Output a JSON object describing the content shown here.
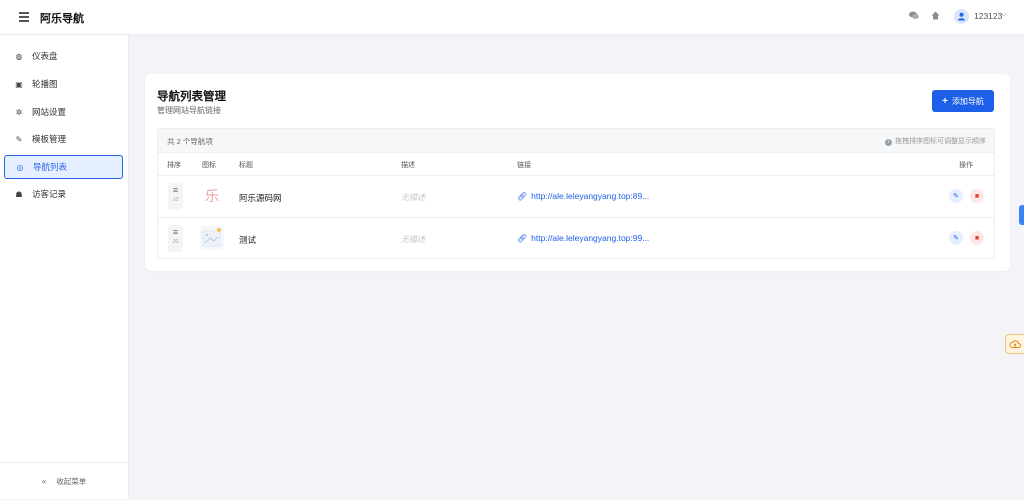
{
  "header": {
    "brand": "阿乐导航",
    "username": "123123"
  },
  "sidebar": {
    "items": [
      {
        "label": "仪表盘",
        "icon": "dashboard-icon",
        "glyph": "◍"
      },
      {
        "label": "轮播图",
        "icon": "image-icon",
        "glyph": "▣"
      },
      {
        "label": "网站设置",
        "icon": "gear-icon",
        "glyph": "✲"
      },
      {
        "label": "模板管理",
        "icon": "brush-icon",
        "glyph": "✎"
      },
      {
        "label": "导航列表",
        "icon": "compass-icon",
        "glyph": "◎"
      },
      {
        "label": "访客记录",
        "icon": "users-icon",
        "glyph": "☗"
      }
    ],
    "active_index": 4,
    "collapse_label": "收起菜单"
  },
  "card": {
    "title": "导航列表管理",
    "subtitle": "管理网站导航链接",
    "add_button_label": "添加导航"
  },
  "table": {
    "count_text": "共 2 个导航项",
    "hint_text": "拖拽排序图标可调整显示顺序",
    "columns": [
      "排序",
      "图标",
      "标题",
      "描述",
      "链接",
      "操作"
    ],
    "rows": [
      {
        "sort": "10",
        "title": "阿乐源码网",
        "description": "无描述",
        "link": "http://ale.leleyangyang.top:89...",
        "thumb_text": "乐"
      },
      {
        "sort": "20",
        "title": "测试",
        "description": "无描述",
        "link": "http://ale.leleyangyang.top:99..."
      }
    ]
  },
  "colors": {
    "accent": "#1d5fe8",
    "danger": "#e53935",
    "background": "#f3f4f8",
    "active_bg": "#e6efff"
  }
}
